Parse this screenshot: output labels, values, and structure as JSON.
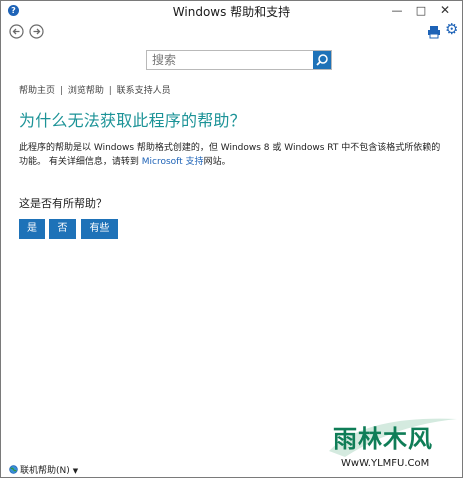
{
  "window": {
    "title": "Windows 帮助和支持",
    "minimize": "—",
    "maximize": "□",
    "close": "✕"
  },
  "search": {
    "placeholder": "搜索"
  },
  "breadcrumb": {
    "home": "帮助主页",
    "browse": "浏览帮助",
    "contact": "联系支持人员",
    "separator": "|"
  },
  "article": {
    "title": "为什么无法获取此程序的帮助？",
    "body_before_link": "此程序的帮助是以 Windows 帮助格式创建的，但 Windows 8 或 Windows RT 中不包含该格式所依赖的功能。 有关详细信息，请转到 ",
    "link_text": "Microsoft 支持",
    "body_after_link": "网站。"
  },
  "feedback": {
    "question": "这是否有所帮助？",
    "yes": "是",
    "no": "否",
    "somewhat": "有些"
  },
  "footer": {
    "online_help": "联机帮助(N)",
    "caret": "▼"
  },
  "watermark": {
    "mark": "雨林木风",
    "url": "WwW.YLMFU.CoM"
  },
  "colors": {
    "accent": "#1e72b8",
    "title_teal": "#1c9397",
    "link": "#1e63b7"
  }
}
